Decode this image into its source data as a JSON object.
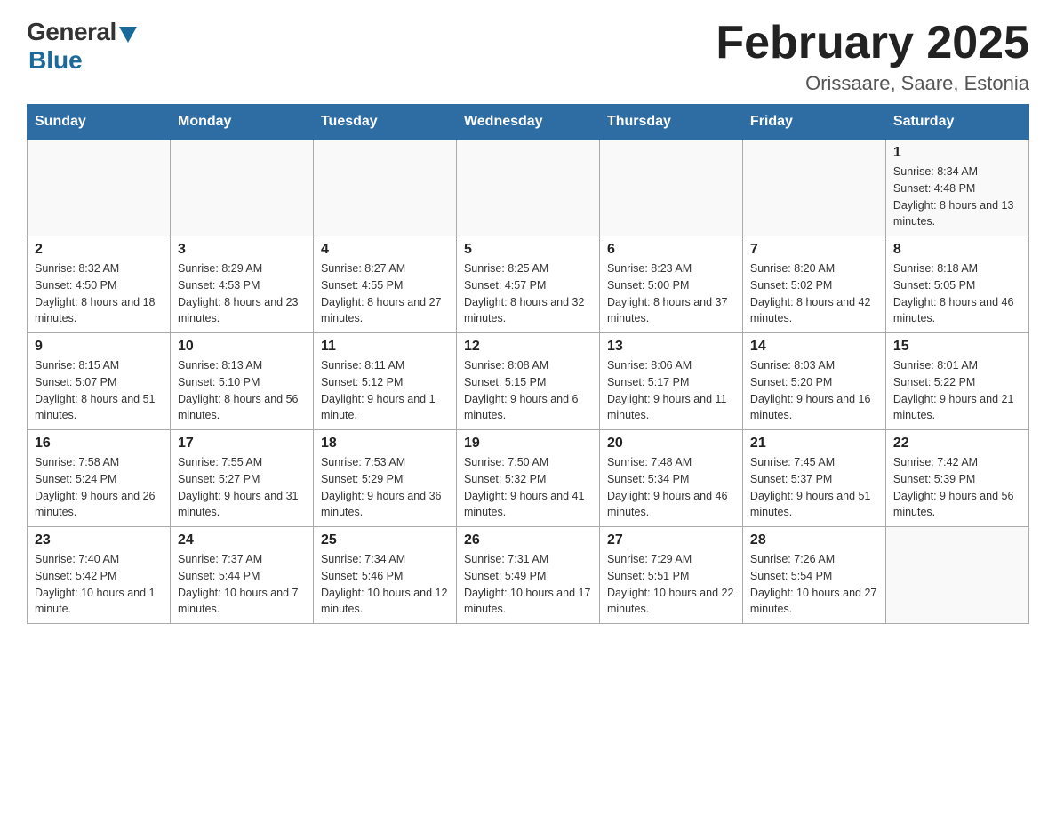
{
  "logo": {
    "general": "General",
    "blue": "Blue",
    "subtitle": "Blue"
  },
  "header": {
    "title": "February 2025",
    "location": "Orissaare, Saare, Estonia"
  },
  "days_of_week": [
    "Sunday",
    "Monday",
    "Tuesday",
    "Wednesday",
    "Thursday",
    "Friday",
    "Saturday"
  ],
  "weeks": [
    [
      {
        "day": "",
        "sunrise": "",
        "sunset": "",
        "daylight": ""
      },
      {
        "day": "",
        "sunrise": "",
        "sunset": "",
        "daylight": ""
      },
      {
        "day": "",
        "sunrise": "",
        "sunset": "",
        "daylight": ""
      },
      {
        "day": "",
        "sunrise": "",
        "sunset": "",
        "daylight": ""
      },
      {
        "day": "",
        "sunrise": "",
        "sunset": "",
        "daylight": ""
      },
      {
        "day": "",
        "sunrise": "",
        "sunset": "",
        "daylight": ""
      },
      {
        "day": "1",
        "sunrise": "Sunrise: 8:34 AM",
        "sunset": "Sunset: 4:48 PM",
        "daylight": "Daylight: 8 hours and 13 minutes."
      }
    ],
    [
      {
        "day": "2",
        "sunrise": "Sunrise: 8:32 AM",
        "sunset": "Sunset: 4:50 PM",
        "daylight": "Daylight: 8 hours and 18 minutes."
      },
      {
        "day": "3",
        "sunrise": "Sunrise: 8:29 AM",
        "sunset": "Sunset: 4:53 PM",
        "daylight": "Daylight: 8 hours and 23 minutes."
      },
      {
        "day": "4",
        "sunrise": "Sunrise: 8:27 AM",
        "sunset": "Sunset: 4:55 PM",
        "daylight": "Daylight: 8 hours and 27 minutes."
      },
      {
        "day": "5",
        "sunrise": "Sunrise: 8:25 AM",
        "sunset": "Sunset: 4:57 PM",
        "daylight": "Daylight: 8 hours and 32 minutes."
      },
      {
        "day": "6",
        "sunrise": "Sunrise: 8:23 AM",
        "sunset": "Sunset: 5:00 PM",
        "daylight": "Daylight: 8 hours and 37 minutes."
      },
      {
        "day": "7",
        "sunrise": "Sunrise: 8:20 AM",
        "sunset": "Sunset: 5:02 PM",
        "daylight": "Daylight: 8 hours and 42 minutes."
      },
      {
        "day": "8",
        "sunrise": "Sunrise: 8:18 AM",
        "sunset": "Sunset: 5:05 PM",
        "daylight": "Daylight: 8 hours and 46 minutes."
      }
    ],
    [
      {
        "day": "9",
        "sunrise": "Sunrise: 8:15 AM",
        "sunset": "Sunset: 5:07 PM",
        "daylight": "Daylight: 8 hours and 51 minutes."
      },
      {
        "day": "10",
        "sunrise": "Sunrise: 8:13 AM",
        "sunset": "Sunset: 5:10 PM",
        "daylight": "Daylight: 8 hours and 56 minutes."
      },
      {
        "day": "11",
        "sunrise": "Sunrise: 8:11 AM",
        "sunset": "Sunset: 5:12 PM",
        "daylight": "Daylight: 9 hours and 1 minute."
      },
      {
        "day": "12",
        "sunrise": "Sunrise: 8:08 AM",
        "sunset": "Sunset: 5:15 PM",
        "daylight": "Daylight: 9 hours and 6 minutes."
      },
      {
        "day": "13",
        "sunrise": "Sunrise: 8:06 AM",
        "sunset": "Sunset: 5:17 PM",
        "daylight": "Daylight: 9 hours and 11 minutes."
      },
      {
        "day": "14",
        "sunrise": "Sunrise: 8:03 AM",
        "sunset": "Sunset: 5:20 PM",
        "daylight": "Daylight: 9 hours and 16 minutes."
      },
      {
        "day": "15",
        "sunrise": "Sunrise: 8:01 AM",
        "sunset": "Sunset: 5:22 PM",
        "daylight": "Daylight: 9 hours and 21 minutes."
      }
    ],
    [
      {
        "day": "16",
        "sunrise": "Sunrise: 7:58 AM",
        "sunset": "Sunset: 5:24 PM",
        "daylight": "Daylight: 9 hours and 26 minutes."
      },
      {
        "day": "17",
        "sunrise": "Sunrise: 7:55 AM",
        "sunset": "Sunset: 5:27 PM",
        "daylight": "Daylight: 9 hours and 31 minutes."
      },
      {
        "day": "18",
        "sunrise": "Sunrise: 7:53 AM",
        "sunset": "Sunset: 5:29 PM",
        "daylight": "Daylight: 9 hours and 36 minutes."
      },
      {
        "day": "19",
        "sunrise": "Sunrise: 7:50 AM",
        "sunset": "Sunset: 5:32 PM",
        "daylight": "Daylight: 9 hours and 41 minutes."
      },
      {
        "day": "20",
        "sunrise": "Sunrise: 7:48 AM",
        "sunset": "Sunset: 5:34 PM",
        "daylight": "Daylight: 9 hours and 46 minutes."
      },
      {
        "day": "21",
        "sunrise": "Sunrise: 7:45 AM",
        "sunset": "Sunset: 5:37 PM",
        "daylight": "Daylight: 9 hours and 51 minutes."
      },
      {
        "day": "22",
        "sunrise": "Sunrise: 7:42 AM",
        "sunset": "Sunset: 5:39 PM",
        "daylight": "Daylight: 9 hours and 56 minutes."
      }
    ],
    [
      {
        "day": "23",
        "sunrise": "Sunrise: 7:40 AM",
        "sunset": "Sunset: 5:42 PM",
        "daylight": "Daylight: 10 hours and 1 minute."
      },
      {
        "day": "24",
        "sunrise": "Sunrise: 7:37 AM",
        "sunset": "Sunset: 5:44 PM",
        "daylight": "Daylight: 10 hours and 7 minutes."
      },
      {
        "day": "25",
        "sunrise": "Sunrise: 7:34 AM",
        "sunset": "Sunset: 5:46 PM",
        "daylight": "Daylight: 10 hours and 12 minutes."
      },
      {
        "day": "26",
        "sunrise": "Sunrise: 7:31 AM",
        "sunset": "Sunset: 5:49 PM",
        "daylight": "Daylight: 10 hours and 17 minutes."
      },
      {
        "day": "27",
        "sunrise": "Sunrise: 7:29 AM",
        "sunset": "Sunset: 5:51 PM",
        "daylight": "Daylight: 10 hours and 22 minutes."
      },
      {
        "day": "28",
        "sunrise": "Sunrise: 7:26 AM",
        "sunset": "Sunset: 5:54 PM",
        "daylight": "Daylight: 10 hours and 27 minutes."
      },
      {
        "day": "",
        "sunrise": "",
        "sunset": "",
        "daylight": ""
      }
    ]
  ]
}
